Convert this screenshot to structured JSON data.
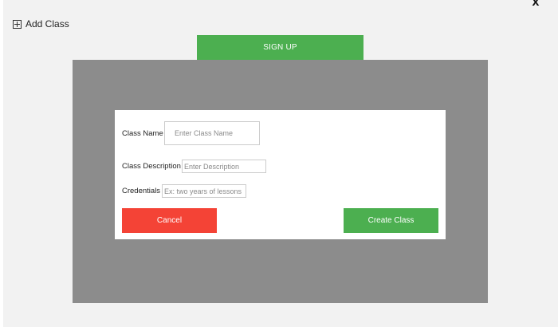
{
  "header": {
    "add_class_label": "Add Class",
    "close_glyph": "x"
  },
  "tabs": {
    "signup_label": "SIGN UP"
  },
  "form": {
    "class_name": {
      "label": "Class Name",
      "value": "",
      "placeholder": "Enter Class Name"
    },
    "class_description": {
      "label": "Class Description",
      "value": "",
      "placeholder": "Enter Description"
    },
    "credentials": {
      "label": "Credentials",
      "value": "",
      "placeholder": "Ex: two years of lessons"
    },
    "cancel_label": "Cancel",
    "create_label": "Create Class"
  },
  "icons": {
    "add": "plus-square-icon",
    "close": "close-icon"
  },
  "colors": {
    "accent_green": "#4caf50",
    "danger_red": "#f44336",
    "overlay_gray": "#8c8c8c",
    "page_background": "#f2f2f2"
  }
}
